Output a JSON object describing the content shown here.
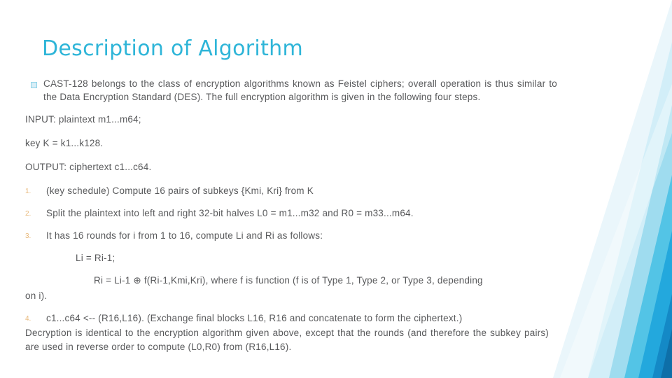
{
  "slide": {
    "title": "Description of Algorithm",
    "bullet": {
      "marker": "square-bullet",
      "text": "CAST-128 belongs to the class of encryption algorithms known as Feistel ciphers; overall operation is thus similar to the Data Encryption Standard (DES).  The full encryption algorithm is given in  the following four steps."
    },
    "paragraphs": [
      "INPUT:  plaintext m1...m64;",
      "key K = k1...k128.",
      "OUTPUT: ciphertext c1...c64."
    ],
    "steps": [
      {
        "number": "1.",
        "text": "(key schedule) Compute 16 pairs of subkeys {Kmi, Kri} from K"
      },
      {
        "number": "2.",
        "text": "Split the plaintext into left and right 32-bit halves L0 = m1...m32 and R0 = m33...m64."
      },
      {
        "number": "3.",
        "text": "It has 16 rounds for i from 1 to 16, compute Li and Ri as follows:"
      }
    ],
    "formula_1": "Li = Ri-1;",
    "formula_2": "Ri = Li-1 ⊕ f(Ri-1,Kmi,Kri), where f is  function (f is of Type 1, Type 2, or Type 3, depending",
    "formula_2_cont": "on i).",
    "step_4": {
      "number": "4.",
      "text": "c1...c64 <-- (R16,L16).  (Exchange final blocks L16, R16 and concatenate to form the ciphertext.)"
    },
    "footer": "Decryption is identical to the encryption algorithm given above, except that the rounds (and therefore the subkey pairs) are used in reverse order to compute (L0,R0) from (R16,L16).",
    "colors": {
      "title": "#2eb5d8",
      "body": "#58595b",
      "number_marker": "#e8b87a",
      "accent_dark": "#1c9ad6",
      "accent_mid": "#3fc0e0",
      "accent_light": "#bfe6f3"
    }
  }
}
